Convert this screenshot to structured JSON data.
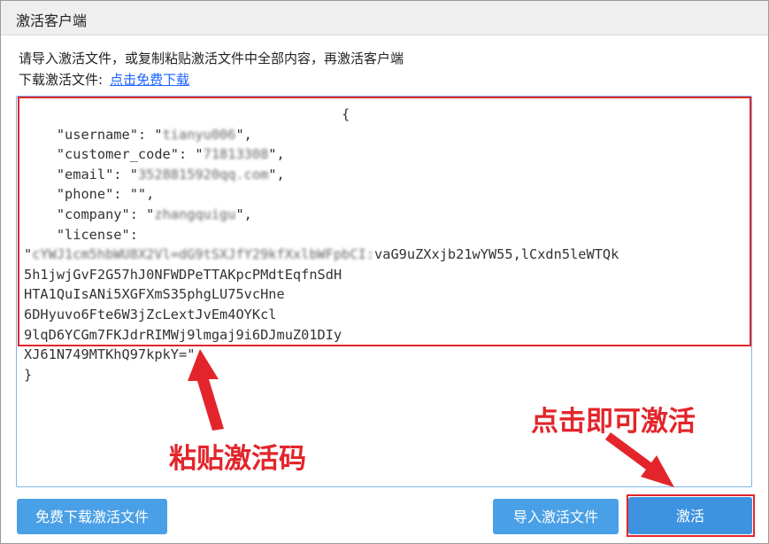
{
  "window": {
    "title": "激活客户端"
  },
  "instructions": {
    "line1": "请导入激活文件，或复制粘贴激活文件中全部内容，再激活客户端",
    "download_label": "下载激活文件:",
    "download_link": "点击免费下载"
  },
  "editor": {
    "lines": [
      "                                       {",
      "    \"username\": \"",
      "tianyu006",
      "\",",
      "    \"customer_code\": \"",
      "71813308",
      "\",",
      "    \"email\": \"",
      "3528815920qq.com",
      "\",",
      "    \"phone\": \"\",",
      "    \"company\": \"",
      "zhangquigu",
      "\",",
      "    \"license\":",
      "\"",
      "cYWJ1cm5hbWU8X2Vl=dG9tSXJfY29kfXxlbWFpbCI:",
      "vaG9uZXxjb21wYW55,lCxdn5leWTQk",
      "5h1jwjGvF2G57hJ0NFWDPeTTAKpcPMdtEqfnSdH",
      "HTA1QuIsANi5XGFXmS35phgLU75vcHne",
      "6DHyuvo6Fte6W3jZcLextJvEm4OYKcl",
      "9lqD6YCGm7FKJdrRIMWj9lmgaj9i6DJmuZ01DIy",
      "XJ61N749MTKhQ97kpkY=\"",
      "}"
    ]
  },
  "annotations": {
    "paste_label": "粘贴激活码",
    "click_label": "点击即可激活",
    "color": "#e3252b"
  },
  "buttons": {
    "free_download": "免费下载激活文件",
    "import_file": "导入激活文件",
    "activate": "激活"
  },
  "colors": {
    "button": "#4aa0e6",
    "link": "#1a63ff",
    "highlight": "#e3252b"
  }
}
